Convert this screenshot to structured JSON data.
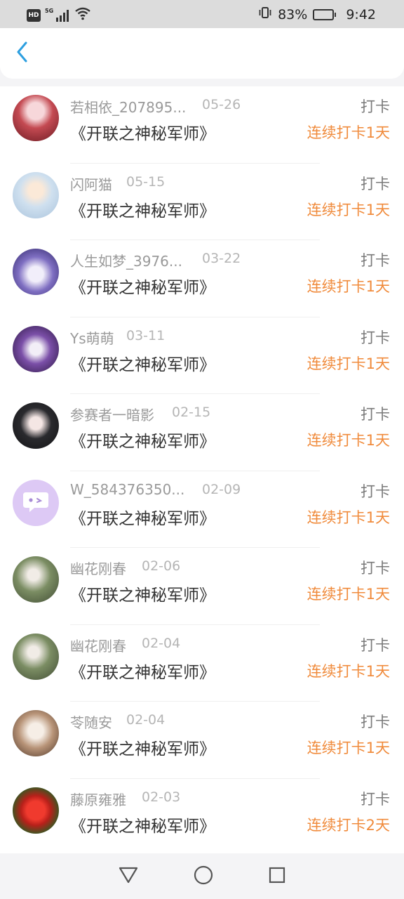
{
  "status_bar": {
    "network_badge": "HD",
    "signal_label": "5G",
    "battery_percent": "83%",
    "battery_level": 0.83,
    "time": "9:42"
  },
  "icons": {
    "back": "chevron-left-icon",
    "nav_back": "triangle-back-icon",
    "nav_home": "circle-home-icon",
    "nav_recents": "square-recents-icon"
  },
  "colors": {
    "accent": "#2d9fe0",
    "streak": "#f08b3c"
  },
  "records": [
    {
      "name": "若相依_207895...",
      "date": "05-26",
      "type": "打卡",
      "title": "《开联之神秘军师》",
      "streak": "连续打卡1天"
    },
    {
      "name": "闪阿猫",
      "date": "05-15",
      "type": "打卡",
      "title": "《开联之神秘军师》",
      "streak": "连续打卡1天"
    },
    {
      "name": "人生如梦_3976...",
      "date": "03-22",
      "type": "打卡",
      "title": "《开联之神秘军师》",
      "streak": "连续打卡1天"
    },
    {
      "name": "Ys萌萌",
      "date": "03-11",
      "type": "打卡",
      "title": "《开联之神秘军师》",
      "streak": "连续打卡1天"
    },
    {
      "name": "参赛者一暗影",
      "date": "02-15",
      "type": "打卡",
      "title": "《开联之神秘军师》",
      "streak": "连续打卡1天"
    },
    {
      "name": "W_584376350...",
      "date": "02-09",
      "type": "打卡",
      "title": "《开联之神秘军师》",
      "streak": "连续打卡1天"
    },
    {
      "name": "幽花刚春",
      "date": "02-06",
      "type": "打卡",
      "title": "《开联之神秘军师》",
      "streak": "连续打卡1天"
    },
    {
      "name": "幽花刚春",
      "date": "02-04",
      "type": "打卡",
      "title": "《开联之神秘军师》",
      "streak": "连续打卡1天"
    },
    {
      "name": "苓随安",
      "date": "02-04",
      "type": "打卡",
      "title": "《开联之神秘军师》",
      "streak": "连续打卡1天"
    },
    {
      "name": "藤原雍雅",
      "date": "02-03",
      "type": "打卡",
      "title": "《开联之神秘军师》",
      "streak": "连续打卡2天"
    }
  ]
}
